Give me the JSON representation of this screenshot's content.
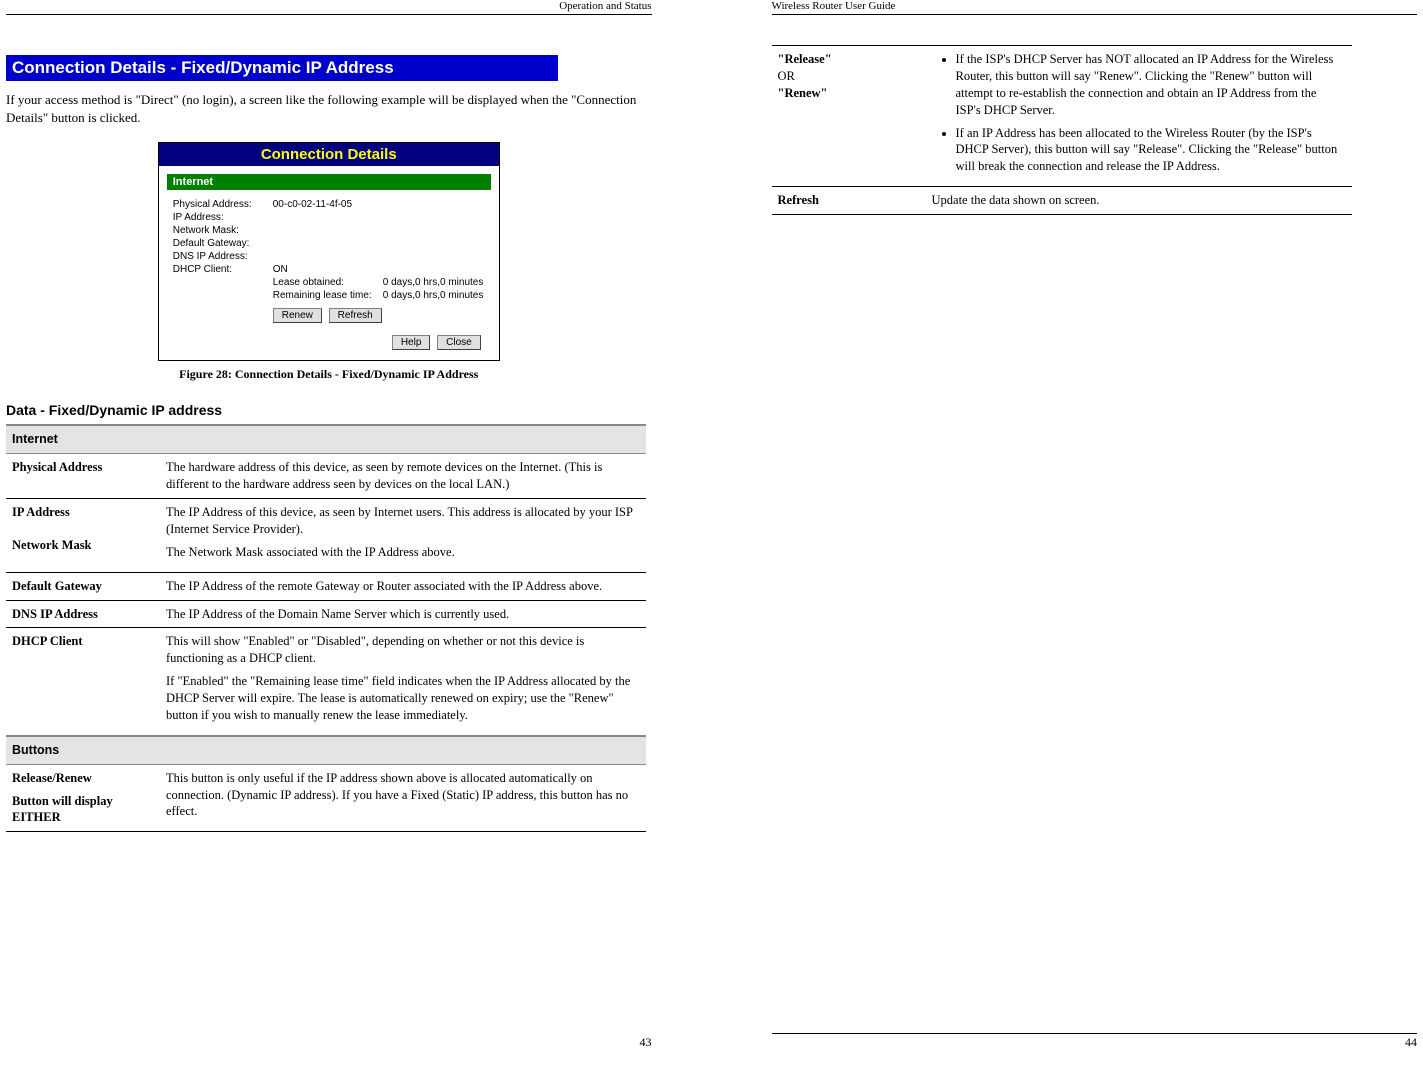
{
  "leftPage": {
    "runningHeader": "Operation and Status",
    "title": "Connection Details - Fixed/Dynamic IP Address",
    "intro": "If your access method is \"Direct\" (no login), a screen like the following example will be dis­played when the \"Connection Details\" button is clicked.",
    "caption": "Figure 28: Connection Details - Fixed/Dynamic IP Address",
    "subhead": "Data - Fixed/Dynamic IP address",
    "page": "43"
  },
  "dialog": {
    "title": "Connection Details",
    "section": "Internet",
    "rows": {
      "phys_lbl": "Physical Address:",
      "phys_val": "00-c0-02-11-4f-05",
      "ip_lbl": "IP Address:",
      "mask_lbl": "Network Mask:",
      "gw_lbl": "Default Gateway:",
      "dns_lbl": "DNS IP Address:",
      "dhcp_lbl": "DHCP Client:",
      "dhcp_val": "ON",
      "lease_lbl": "Lease obtained:",
      "lease_val": "0 days,0 hrs,0 minutes",
      "rem_lbl": "Remaining lease time:",
      "rem_val": "0 days,0 hrs,0 minutes"
    },
    "buttons": {
      "renew": "Renew",
      "refresh": "Refresh",
      "help": "Help",
      "close": "Close"
    }
  },
  "table1": {
    "sec_internet": "Internet",
    "physaddr_k": "Physical Address",
    "physaddr_v": "The hardware address of this device, as seen by remote devices on the Internet. (This is different to the hardware address seen by de­vices on the local LAN.)",
    "ipaddr_k": "IP Address",
    "ipaddr_v": "The IP Address of this device, as seen by Internet users. This ad­dress is allocated by your ISP (Internet Service Provider).",
    "mask_k": "Network Mask",
    "mask_v": "The Network Mask associated with the IP Address above.",
    "gw_k": "Default Gateway",
    "gw_v": "The IP Address of the remote Gateway or Router associated with the IP Address above.",
    "dns_k": "DNS IP Address",
    "dns_v": "The IP Address of the Domain Name Server which is currently used.",
    "dhcp_k": "DHCP Client",
    "dhcp_v1": "This will show \"Enabled\" or \"Disabled\", depending on whether or not this device is functioning as a DHCP client.",
    "dhcp_v2": "If \"Enabled\" the \"Remaining lease time\" field indicates when the IP Address allocated by the DHCP Server will expire. The lease is auto­matically renewed on expiry; use the \"Renew\" button if you wish to manually renew the lease immediately.",
    "sec_buttons": "Buttons",
    "rr_k1": "Release/Renew",
    "rr_k2": "Button will display EITHER",
    "rr_v": "This button is only useful if the IP address shown above is allocated automatically on connection. (Dynamic IP address). If you have a Fixed (Static) IP address, this button has no effect."
  },
  "rightPage": {
    "runningHeader": "Wireless Router User Guide",
    "page": "44"
  },
  "table2": {
    "rr_k1": "\"Release\"",
    "rr_k2": "OR",
    "rr_k3": "\"Renew\"",
    "rr_b1": "If the ISP's DHCP Server has NOT allocated an IP Address for the Wireless Router, this button will say \"Renew\". Clicking the \"Re­new\" button will attempt to re-establish the connection and obtain an IP Address from the ISP's DHCP Server.",
    "rr_b2": "If an IP Address has been allocated to the Wireless Router (by the ISP's DHCP Server), this button will say \"Release\". Clicking the \"Release\" button will break the connection and release the IP Address.",
    "refresh_k": "Refresh",
    "refresh_v": "Update the data shown on screen."
  }
}
